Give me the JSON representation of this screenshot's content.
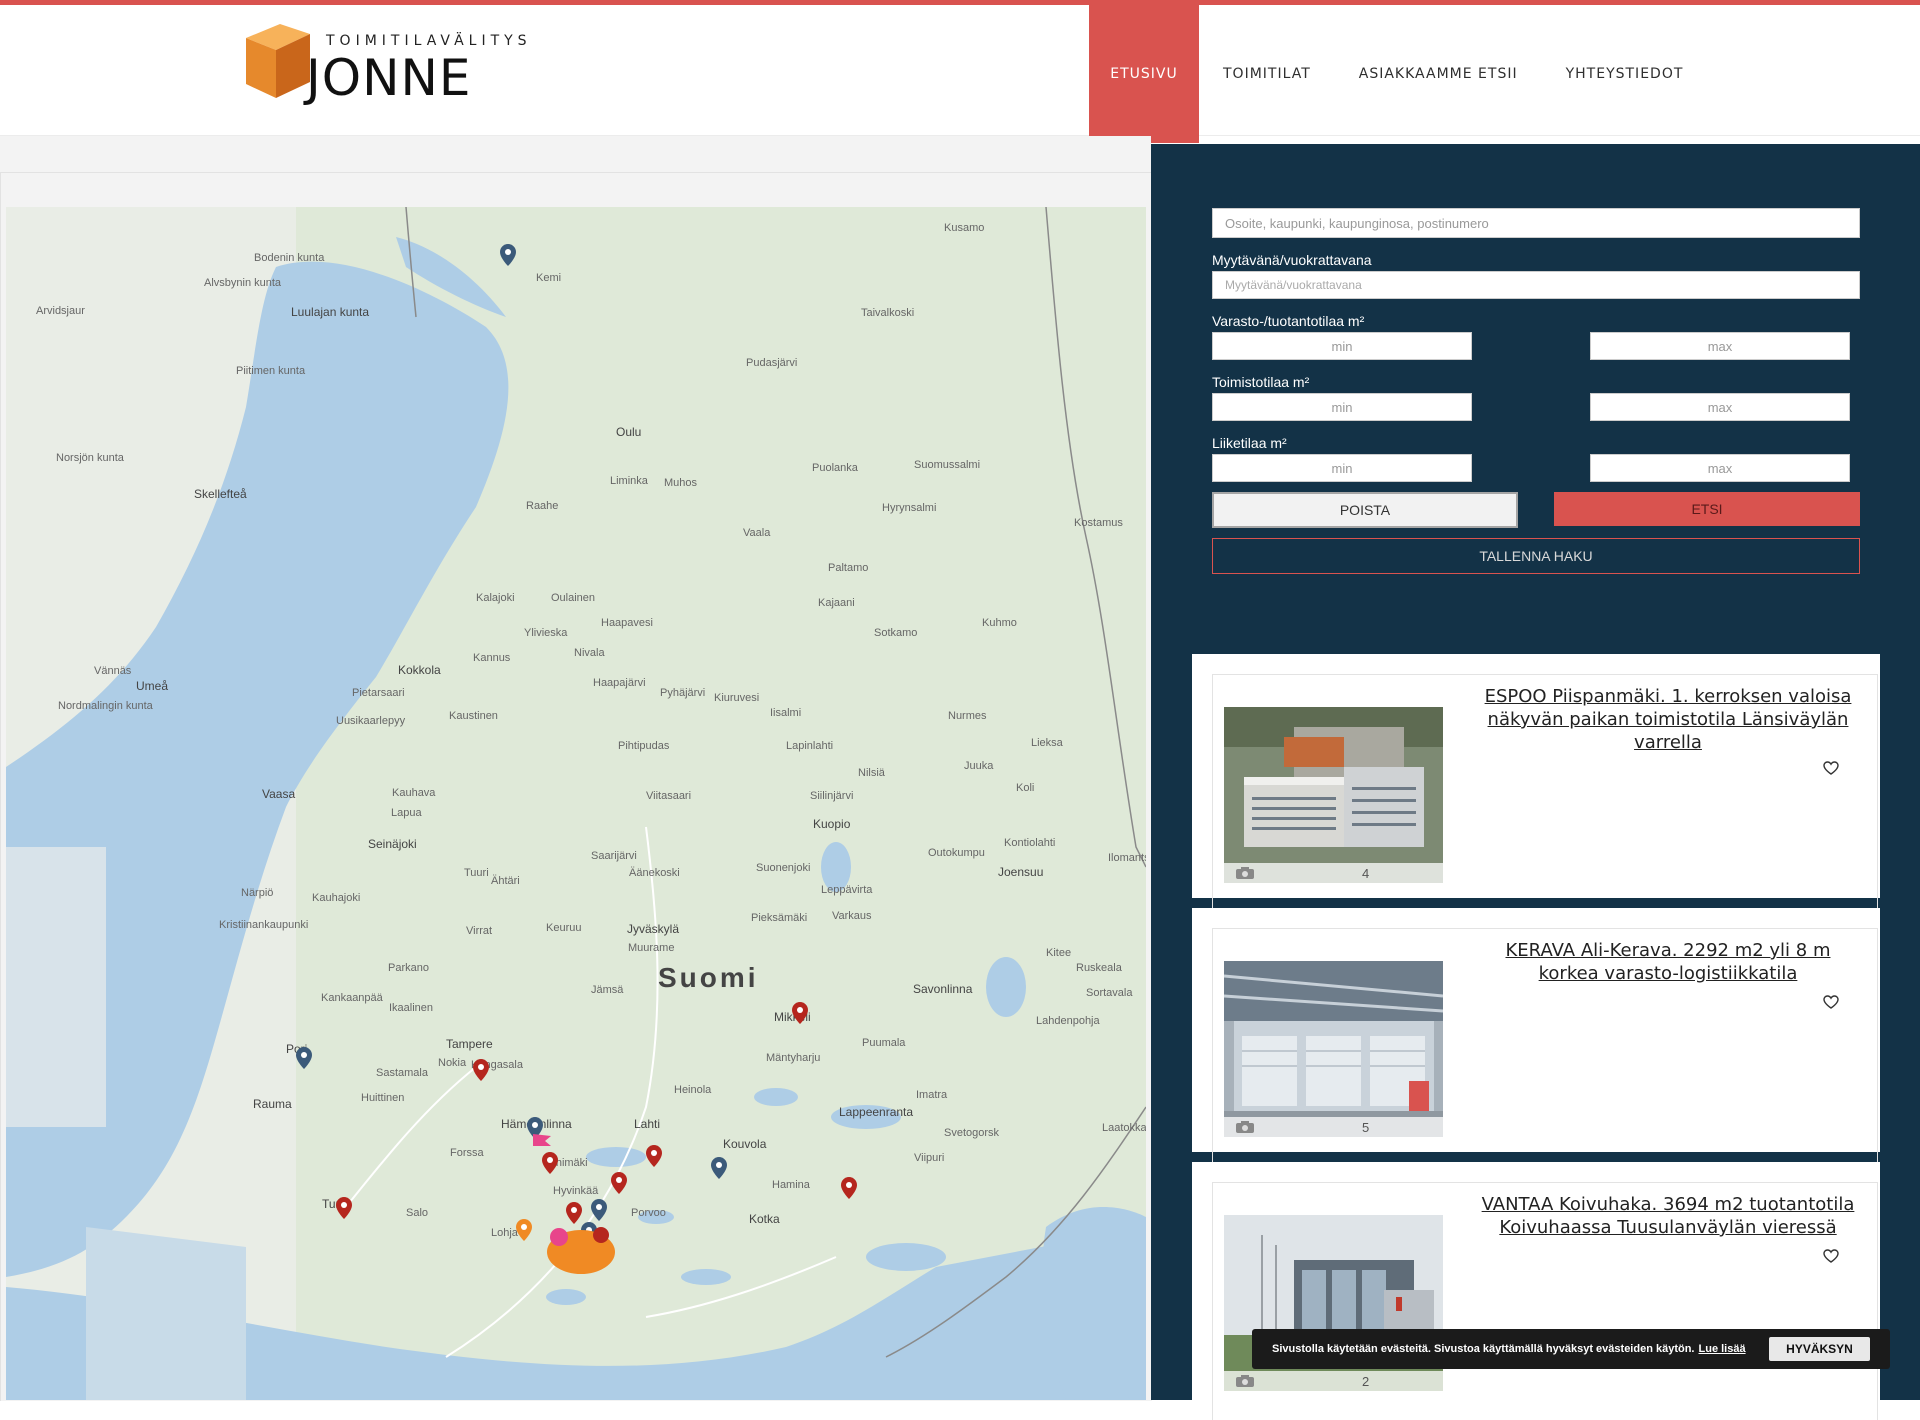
{
  "brand": {
    "logo_top": "TOIMITILAVÄLITYS",
    "logo_main": "JONNE",
    "accent": "#d9534f",
    "panel_bg": "#133247"
  },
  "nav": {
    "items": [
      {
        "label": "ETUSIVU",
        "active": true
      },
      {
        "label": "TOIMITILAT",
        "active": false
      },
      {
        "label": "ASIAKKAAMME ETSII",
        "active": false
      },
      {
        "label": "YHTEYSTIEDOT",
        "active": false
      }
    ]
  },
  "map": {
    "country_label": "Suomi",
    "labels": [
      "Kusamo",
      "Bodenin kunta",
      "Kemi",
      "Alvsbynin kunta",
      "Luulajan kunta",
      "Arvidsjaur",
      "Taivalkoski",
      "Piitimen kunta",
      "Pudasjärvi",
      "Oulu",
      "Norsjön kunta",
      "Skellefteå",
      "Liminka",
      "Muhos",
      "Puolanka",
      "Suomussalmi",
      "Raahe",
      "Hyrynsalmi",
      "Vaala",
      "Paltamo",
      "Kajaani",
      "Kalajoki",
      "Oulainen",
      "Haapavesi",
      "Ylivieska",
      "Kuhmo",
      "Sotkamo",
      "Kokkola",
      "Kannus",
      "Nivala",
      "Haapajärvi",
      "Pietarsaari",
      "Pyhäjärvi",
      "Kiuruvesi",
      "Iisalmi",
      "Nurmes",
      "Uusikaarlepyy",
      "Kaustinen",
      "Pihtipudas",
      "Lapinlahti",
      "Umeå",
      "Vännäs",
      "Nordmalingin kunta",
      "Vaasa",
      "Kauhava",
      "Lapua",
      "Viitasaari",
      "Nilsiä",
      "Siilinjärvi",
      "Juuka",
      "Lieksa",
      "Seinäjoki",
      "Kuopio",
      "Koli",
      "Kontiolahti",
      "Saarijärvi",
      "Äänekoski",
      "Suonenjoki",
      "Outokumpu",
      "Ilomantsi",
      "Tuuri",
      "Ähtäri",
      "Leppävirta",
      "Joensuu",
      "Närpiö",
      "Kauhajoki",
      "Kristiinankaupunki",
      "Virrat",
      "Keuruu",
      "Jyväskylä",
      "Pieksämäki",
      "Varkaus",
      "Muurame",
      "Parkano",
      "Kitee",
      "Jämsä",
      "Savonlinna",
      "Kankaanpää",
      "Ikaalinen",
      "Mikkeli",
      "Tampere",
      "Pori",
      "Nokia",
      "Kangasala",
      "Sastamala",
      "Huittinen",
      "Rauma",
      "Mäntyharju",
      "Puumala",
      "Heinola",
      "Imatra",
      "Lappeenranta",
      "Hämeenlinna",
      "Lahti",
      "Kouvola",
      "Forssa",
      "Riihimäki",
      "Hyvinkää",
      "Hamina",
      "Porvoo",
      "Kotka",
      "Turku",
      "Salo",
      "Lohja",
      "Viipuri",
      "Kostamus",
      "Sortavala",
      "Lahdenpohja",
      "Ruskeala",
      "Svetogorsk",
      "Laatokka"
    ]
  },
  "search": {
    "location_placeholder": "Osoite, kaupunki, kaupunginosa, postinumero",
    "sale_rent_label": "Myytävänä/vuokrattavana",
    "sale_rent_placeholder": "Myytävänä/vuokrattavana",
    "warehouse_label": "Varasto-/tuotantotilaa m²",
    "office_label": "Toimistotilaa m²",
    "retail_label": "Liiketilaa m²",
    "min_placeholder": "min",
    "max_placeholder": "max",
    "clear_label": "POISTA",
    "search_label": "ETSI",
    "save_label": "TALLENNA HAKU"
  },
  "listings": [
    {
      "title": "ESPOO Piispanmäki. 1. kerroksen valoisa näkyvän paikan toimistotila Länsiväylän varrella",
      "photo_count": "4"
    },
    {
      "title": "KERAVA Ali-Kerava. 2292 m2 yli 8 m korkea varasto-logistiikkatila",
      "photo_count": "5"
    },
    {
      "title": "VANTAA Koivuhaka. 3694 m2 tuotantotila Koivuhaassa Tuusulanväylän vieressä",
      "photo_count": "2"
    }
  ],
  "cookie": {
    "text": "Sivustolla käytetään evästeitä. Sivustoa käyttämällä hyväksyt evästeiden käytön.",
    "link": "Lue lisää",
    "accept": "HYVÄKSYN"
  }
}
